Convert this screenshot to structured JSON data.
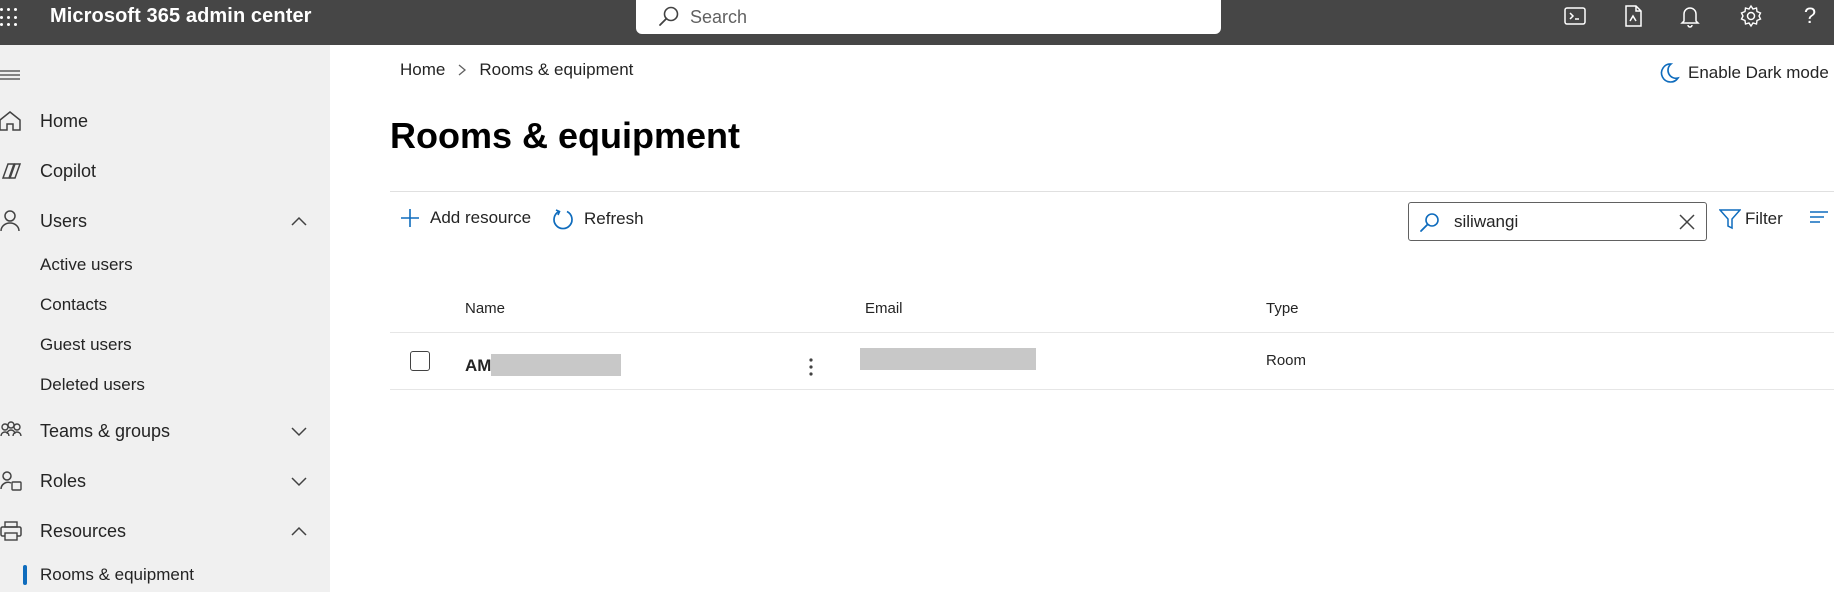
{
  "app": {
    "title": "Microsoft 365 admin center"
  },
  "topbar": {
    "search_placeholder": "Search",
    "icons": [
      "waffle-icon",
      "terminal-icon",
      "document-icon",
      "bell-icon",
      "gear-icon",
      "help-icon"
    ],
    "help_glyph": "?"
  },
  "sidebar": {
    "items": [
      {
        "label": "Home",
        "icon": "home-icon"
      },
      {
        "label": "Copilot",
        "icon": "copilot-icon"
      },
      {
        "label": "Users",
        "icon": "person-icon",
        "expanded": true,
        "children": [
          "Active users",
          "Contacts",
          "Guest users",
          "Deleted users"
        ]
      },
      {
        "label": "Teams & groups",
        "icon": "people-icon",
        "expanded": false
      },
      {
        "label": "Roles",
        "icon": "roles-icon",
        "expanded": false
      },
      {
        "label": "Resources",
        "icon": "printer-icon",
        "expanded": true,
        "children": [
          "Rooms & equipment"
        ]
      }
    ]
  },
  "breadcrumb": {
    "home": "Home",
    "current": "Rooms & equipment"
  },
  "darkmode_label": "Enable Dark mode",
  "page_title": "Rooms & equipment",
  "toolbar": {
    "add_resource": "Add resource",
    "refresh": "Refresh",
    "search_value": "siliwangi",
    "filter": "Filter"
  },
  "table": {
    "columns": [
      "Name",
      "Email",
      "Type"
    ],
    "rows": [
      {
        "name": "AM",
        "email": "",
        "type": "Room"
      }
    ]
  },
  "colors": {
    "topbar": "#464646",
    "sidebar": "#f0f0f0",
    "accent": "#0f6cbd"
  }
}
